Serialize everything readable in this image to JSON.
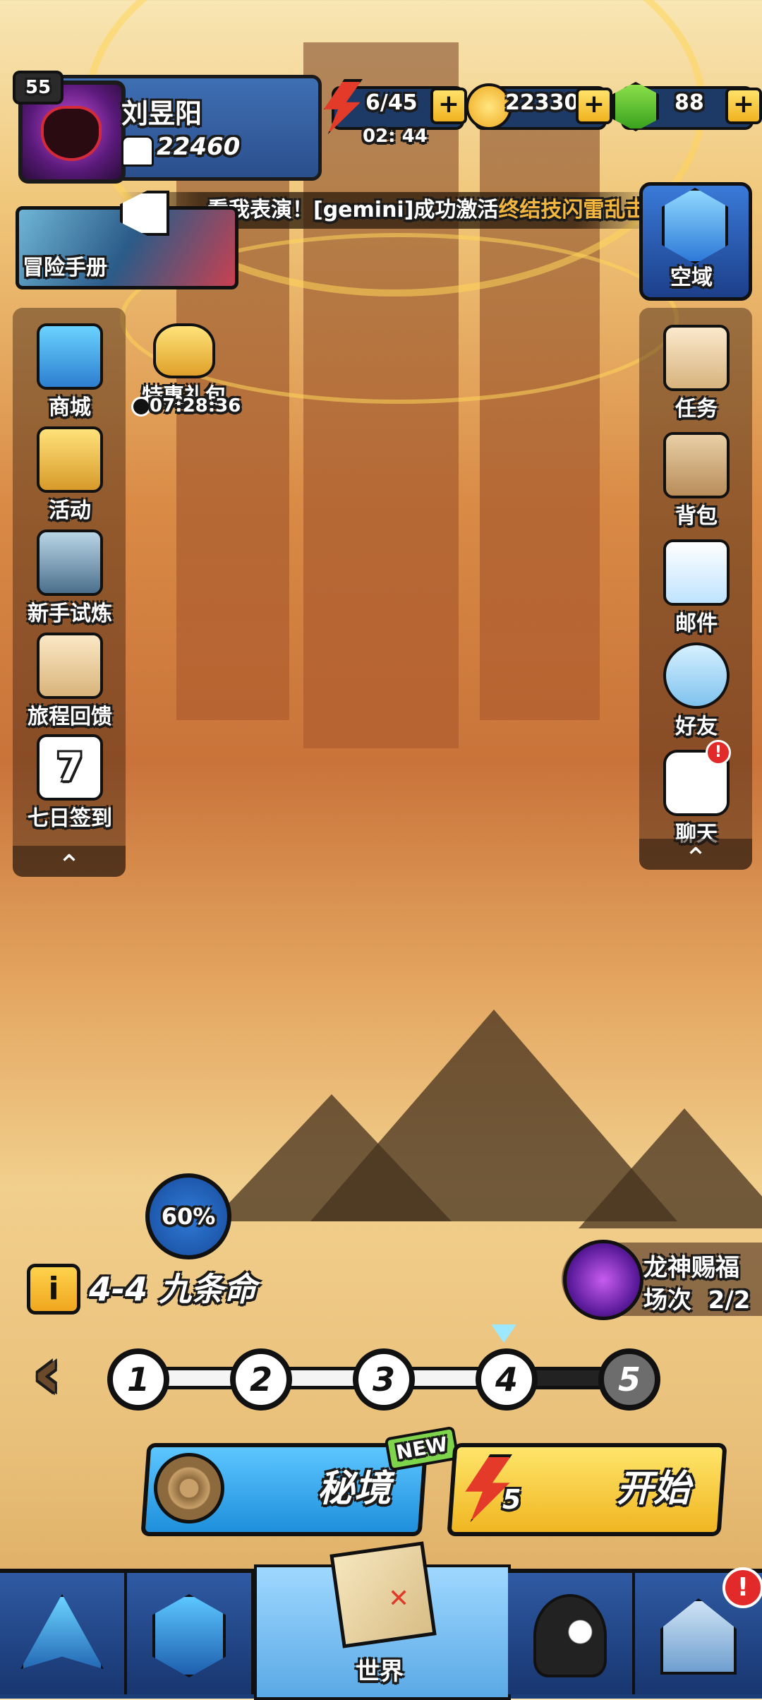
{
  "player": {
    "level": "55",
    "name": "刘昱阳",
    "power": "22460"
  },
  "resources": {
    "energy": "6/45",
    "energy_timer": "02: 44",
    "gold": "22330",
    "gems": "88",
    "plus": "+"
  },
  "marquee": {
    "text_white": "看我表演！[gemini]成功激活",
    "text_gold": "终结技闪雷乱击"
  },
  "adventure_book": {
    "label": "冒险手册"
  },
  "space_domain": {
    "label": "空域"
  },
  "left_menu": [
    {
      "label": "商城",
      "icon": "treasure-chest-icon"
    },
    {
      "label": "活动",
      "icon": "gift-box-icon"
    },
    {
      "label": "新手试炼",
      "icon": "shield-icon"
    },
    {
      "label": "旅程回馈",
      "icon": "clipboard-icon"
    },
    {
      "label": "七日签到",
      "icon": "calendar-icon",
      "calendar_day": "7"
    }
  ],
  "special_pack": {
    "label": "特惠礼包",
    "timer": "07:28:36"
  },
  "right_menu": [
    {
      "label": "任务",
      "icon": "scroll-icon"
    },
    {
      "label": "背包",
      "icon": "backpack-icon"
    },
    {
      "label": "邮件",
      "icon": "mail-icon"
    },
    {
      "label": "好友",
      "icon": "friends-icon"
    },
    {
      "label": "聊天",
      "icon": "chat-icon",
      "badge": "!"
    }
  ],
  "collapse_glyph": "⌃",
  "stage": {
    "progress": "60%",
    "info_glyph": "i",
    "name": "4-4 九条命",
    "nodes": [
      "1",
      "2",
      "3",
      "4",
      "5"
    ],
    "current": "4",
    "locked": [
      "5"
    ],
    "back_glyph": "‹"
  },
  "dragon_blessing": {
    "line1": "龙神赐福",
    "line2": "场次  2/2"
  },
  "buttons": {
    "secret_label": "秘境",
    "new_tag": "NEW",
    "start_label": "开始",
    "start_cost": "5"
  },
  "bottom_nav": {
    "world_label": "世界",
    "badge": "!"
  },
  "colors": {
    "accent_blue": "#2b4f8c",
    "accent_gold": "#f0b622",
    "marquee_gold": "#f2b640"
  }
}
